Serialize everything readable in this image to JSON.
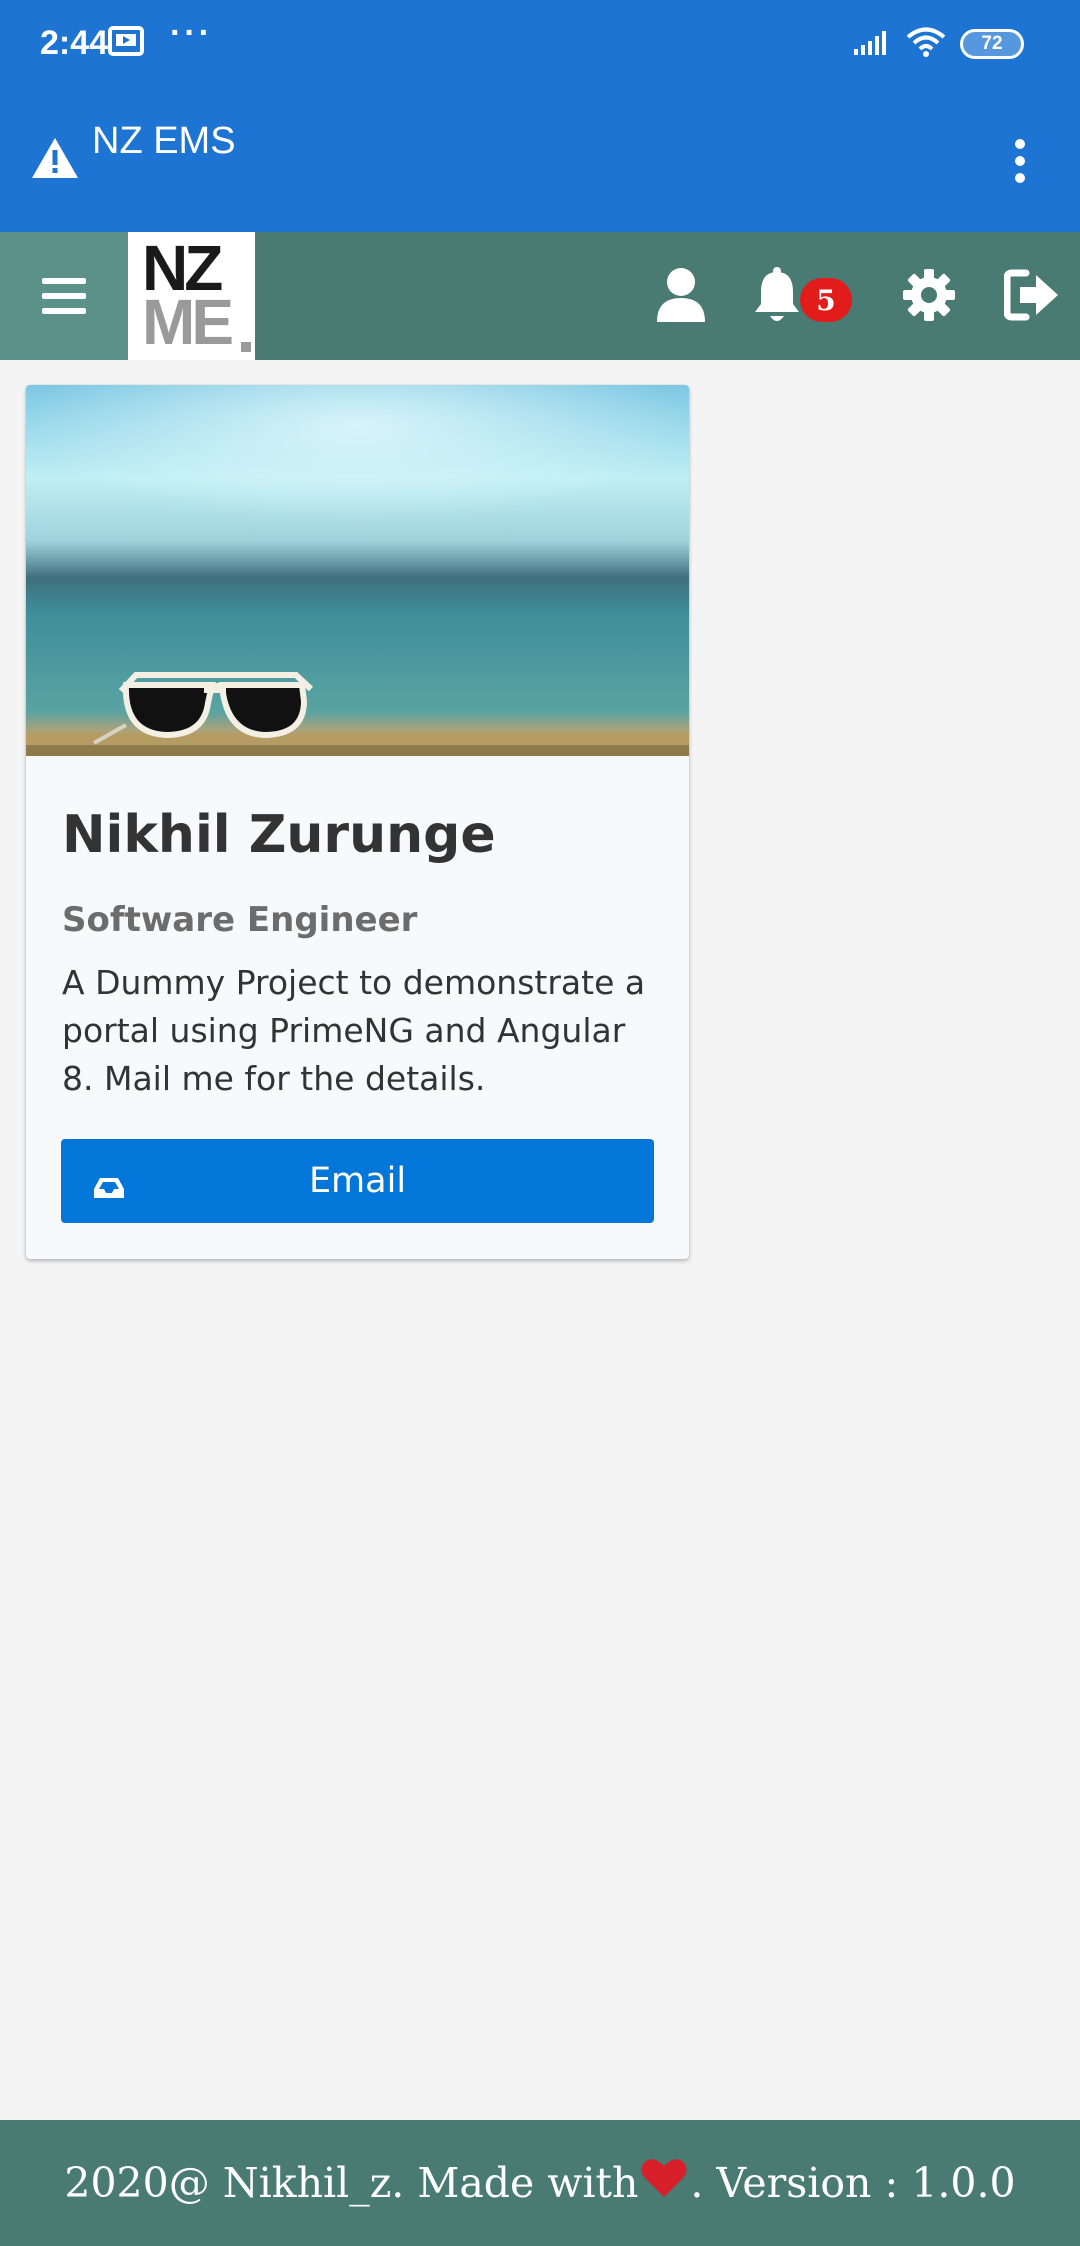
{
  "status_bar": {
    "time": "2:44",
    "battery": "72"
  },
  "app_bar": {
    "title": "NZ EMS"
  },
  "navbar": {
    "logo_top": "NZ",
    "logo_bottom": "ME",
    "notification_count": "5"
  },
  "card": {
    "title": "Nikhil Zurunge",
    "subtitle": "Software Engineer",
    "body": "A Dummy Project to demonstrate a portal using PrimeNG and Angular 8. Mail me for the details.",
    "button_label": "Email"
  },
  "footer": {
    "prefix": "2020@ Nikhil_z. Made with",
    "suffix": ". Version : 1.0.0"
  },
  "colors": {
    "app_bar": "#1e74d2",
    "navbar": "#4a7b72",
    "button": "#0377d9",
    "badge": "#e21b1b"
  }
}
